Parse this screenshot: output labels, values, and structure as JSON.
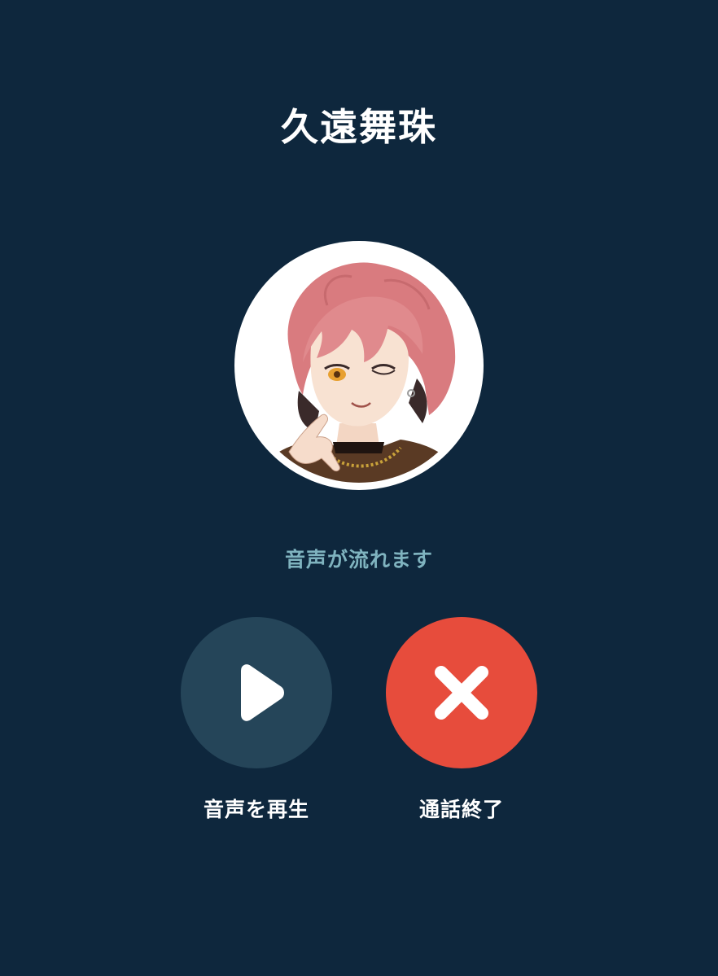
{
  "caller": {
    "name": "久遠舞珠"
  },
  "status": {
    "message": "音声が流れます"
  },
  "actions": {
    "play": {
      "label": "音声を再生",
      "icon": "play-icon"
    },
    "end": {
      "label": "通話終了",
      "icon": "close-icon"
    }
  },
  "colors": {
    "background": "#0e273d",
    "status_text": "#7fb3bf",
    "play_button": "#254559",
    "end_button": "#e74c3c",
    "label_text": "#ffffff"
  }
}
